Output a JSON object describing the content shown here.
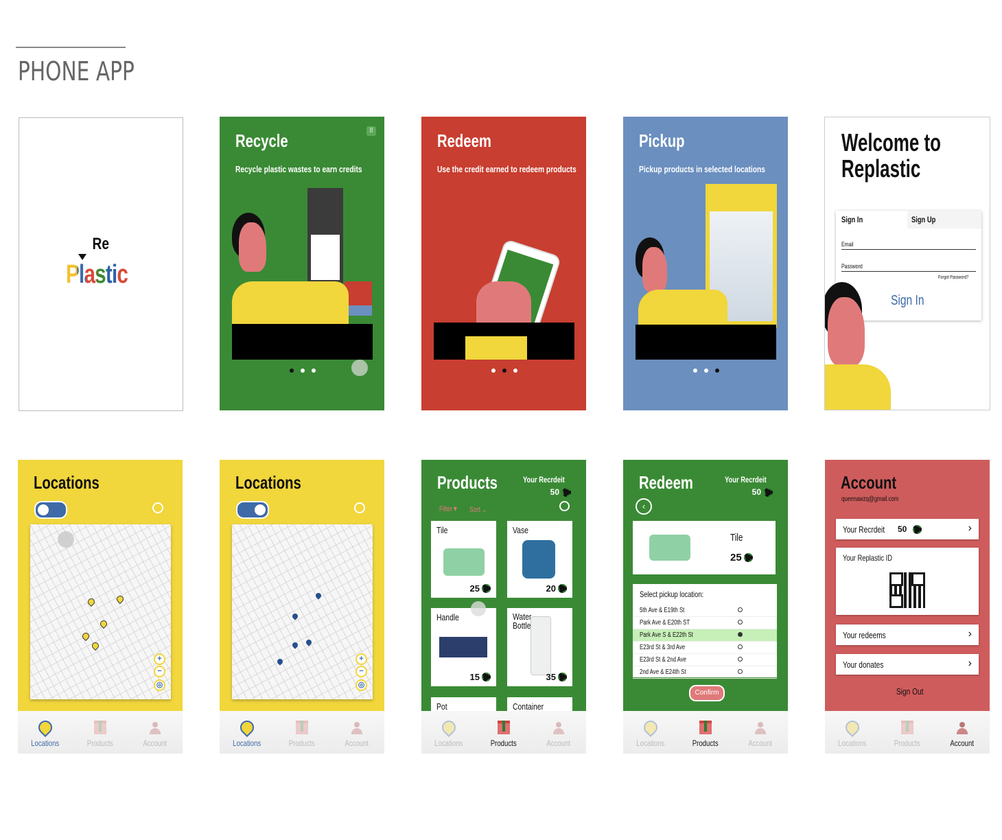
{
  "page": {
    "title": "PHONE APP"
  },
  "colors": {
    "green": "#3a8a35",
    "red": "#c83e30",
    "blue": "#6b8fbf",
    "yellow": "#f1d63c",
    "pink": "#cf5c5c"
  },
  "splash": {
    "logo_top": "Re",
    "logo_bottom": "Plastic"
  },
  "onboarding": [
    {
      "title": "Recycle",
      "subtitle": "Recycle plastic wastes to earn credits"
    },
    {
      "title": "Redeem",
      "subtitle": "Use the credit earned to redeem products"
    },
    {
      "title": "Pickup",
      "subtitle": "Pickup products in selected locations"
    }
  ],
  "login": {
    "title_line1": "Welcome to",
    "title_line2": "Replastic",
    "tab_signin": "Sign In",
    "tab_signup": "Sign Up",
    "email_label": "Email",
    "password_label": "Password",
    "forgot": "Forgot Password?",
    "signin_button": "Sign In"
  },
  "locations": {
    "title": "Locations"
  },
  "tabs": {
    "locations": "Locations",
    "products": "Products",
    "account": "Account"
  },
  "products": {
    "title": "Products",
    "credit_label": "Your Recrdeit",
    "credit_value": "50",
    "filter": "Filter▼",
    "sort": "Sort ⌄",
    "items": [
      {
        "name": "Tile",
        "price": "25"
      },
      {
        "name": "Vase",
        "price": "20"
      },
      {
        "name": "Handle",
        "price": "15"
      },
      {
        "name": "Water Bottle",
        "price": "35"
      },
      {
        "name": "Pot",
        "price": ""
      },
      {
        "name": "Container",
        "price": ""
      }
    ]
  },
  "redeem": {
    "title": "Redeem",
    "credit_label": "Your Recrdeit",
    "credit_value": "50",
    "product_name": "Tile",
    "product_price": "25",
    "pickup_title": "Select pickup location:",
    "locations": [
      "5th Ave & E19th St",
      "Park Ave & E20th ST",
      "Park Ave S & E22th St",
      "E23rd St & 3rd Ave",
      "E23rd St & 2nd Ave",
      "2nd Ave & E24th St"
    ],
    "selected_index": 2,
    "confirm": "Confirm"
  },
  "account": {
    "title": "Account",
    "email": "queenawzq@gmail.com",
    "credit_label": "Your Recrdeit",
    "credit_value": "50",
    "id_label": "Your Replastic ID",
    "redeems": "Your redeems",
    "donates": "Your donates",
    "sign_out": "Sign Out"
  }
}
